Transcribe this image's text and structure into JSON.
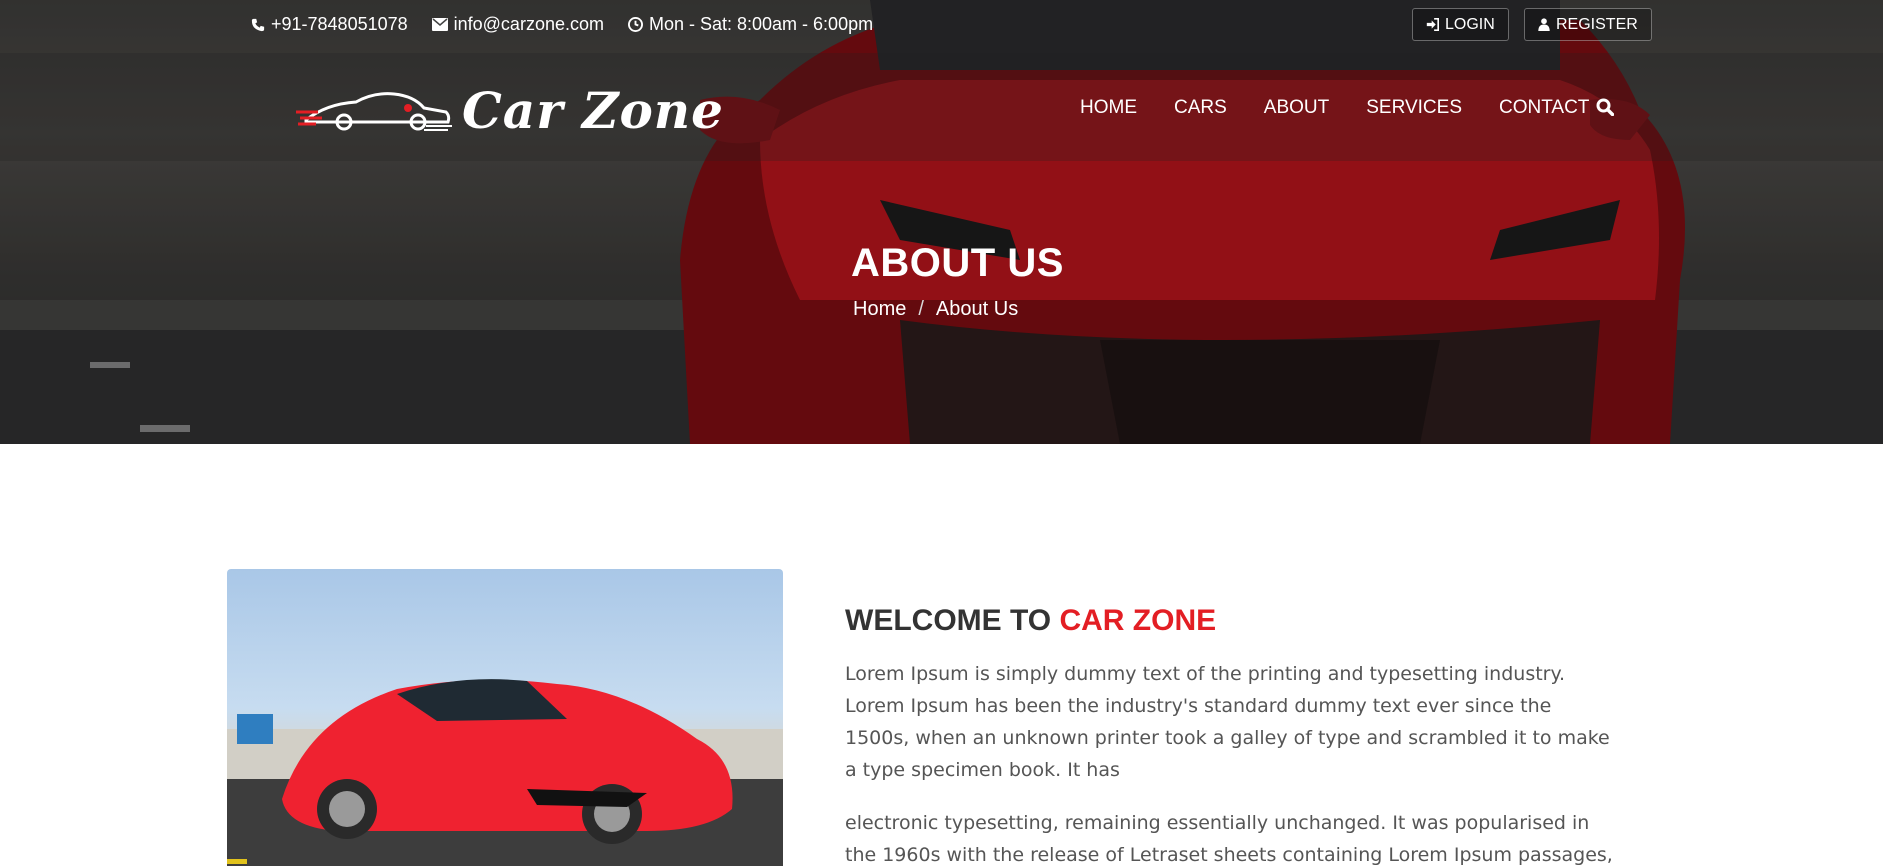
{
  "topbar": {
    "phone": "+91-7848051078",
    "email": "info@carzone.com",
    "hours": "Mon - Sat: 8:00am - 6:00pm",
    "login_label": "LOGIN",
    "register_label": "REGISTER"
  },
  "brand": {
    "name": "Car Zone"
  },
  "nav": {
    "items": [
      {
        "label": "HOME"
      },
      {
        "label": "CARS"
      },
      {
        "label": "ABOUT"
      },
      {
        "label": "SERVICES"
      },
      {
        "label": "CONTACT"
      }
    ]
  },
  "hero": {
    "title": "ABOUT US",
    "breadcrumb": [
      {
        "label": "Home"
      },
      {
        "label": "About Us"
      }
    ],
    "breadcrumb_sep": "/"
  },
  "about": {
    "heading_prefix": "WELCOME TO",
    "heading_accent": "CAR ZONE",
    "paragraphs": [
      "Lorem Ipsum is simply dummy text of the printing and typesetting industry. Lorem Ipsum has been the industry's standard dummy text ever since the 1500s, when an unknown printer took a galley of type and scrambled it to make a type specimen book. It has",
      "electronic typesetting, remaining essentially unchanged. It was popularised in the 1960s with the release of Letraset sheets containing Lorem Ipsum passages, and more"
    ]
  },
  "colors": {
    "accent": "#e31e24",
    "text": "#333333",
    "muted": "#555555"
  },
  "icons": [
    "phone-icon",
    "envelope-icon",
    "clock-icon",
    "sign-in-icon",
    "user-icon",
    "search-icon",
    "car-logo-icon"
  ]
}
